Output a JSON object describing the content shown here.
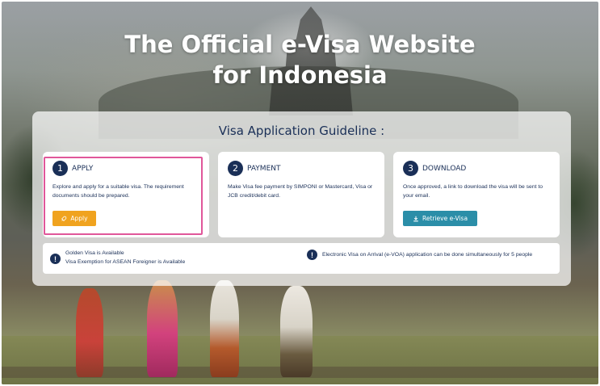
{
  "hero": {
    "title_line1": "The Official e-Visa Website",
    "title_line2": "for Indonesia"
  },
  "guideline": {
    "title": "Visa Application Guideline :",
    "steps": [
      {
        "number": "1",
        "title": "APPLY",
        "description": "Explore and apply for a suitable visa. The requirement documents should be prepared.",
        "button_label": "Apply",
        "button_icon": "rocket-icon"
      },
      {
        "number": "2",
        "title": "PAYMENT",
        "description": "Make Visa fee payment by SIMPONI or Mastercard, Visa or JCB credit/debit card."
      },
      {
        "number": "3",
        "title": "DOWNLOAD",
        "description": "Once approved, a link to download the visa will be sent to your email.",
        "button_label": "Retrieve e-Visa",
        "button_icon": "download-icon"
      }
    ]
  },
  "info": {
    "left_line1": "Golden Visa is Available",
    "left_line2": "Visa Exemption for ASEAN Foreigner is Available",
    "right_text": "Electronic Visa on Arrival (e-VOA) application can be done simultaneously for 5 people",
    "icon": "exclamation-icon"
  },
  "colors": {
    "navy": "#1a2f57",
    "apply_button": "#f0a31f",
    "retrieve_button": "#2b8ea8",
    "highlight_border": "#e0579a"
  }
}
